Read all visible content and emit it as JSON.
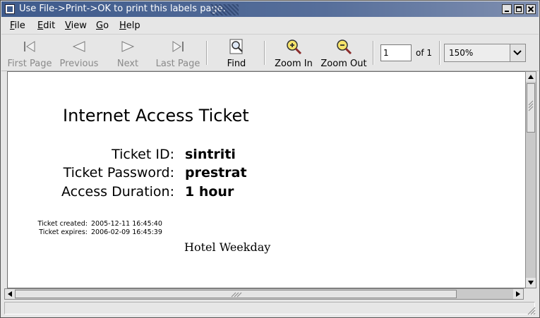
{
  "window": {
    "title": "Use File->Print->OK to print this labels page.",
    "controls": [
      "minimize",
      "maximize",
      "close"
    ]
  },
  "menu": {
    "file": {
      "accel": "F",
      "rest": "ile"
    },
    "edit": {
      "accel": "E",
      "rest": "dit"
    },
    "view": {
      "accel": "V",
      "rest": "iew"
    },
    "go": {
      "accel": "G",
      "rest": "o"
    },
    "help": {
      "accel": "H",
      "rest": "elp"
    }
  },
  "toolbar": {
    "first_page": "First Page",
    "previous": "Previous",
    "next": "Next",
    "last_page": "Last Page",
    "find": "Find",
    "zoom_in": "Zoom In",
    "zoom_out": "Zoom Out",
    "page_value": "1",
    "of_pages": "of 1",
    "zoom_value": "150%",
    "disabled": [
      "first_page",
      "previous",
      "next",
      "last_page"
    ]
  },
  "document": {
    "title": "Internet Access Ticket",
    "fields": [
      {
        "label": "Ticket ID:",
        "value": "sintriti"
      },
      {
        "label": "Ticket Password:",
        "value": "prestrat"
      },
      {
        "label": "Access Duration:",
        "value": "1 hour"
      }
    ],
    "created_label": "Ticket created:",
    "created_value": "2005-12-11 16:45:40",
    "expires_label": "Ticket expires:",
    "expires_value": "2006-02-09 16:45:39",
    "hotel": "Hotel Weekday"
  },
  "status": {
    "text": ""
  },
  "colors": {
    "titlebar": "#3f5b8c",
    "chrome": "#e6e6e6",
    "disabled_text": "#8a8a8a"
  }
}
